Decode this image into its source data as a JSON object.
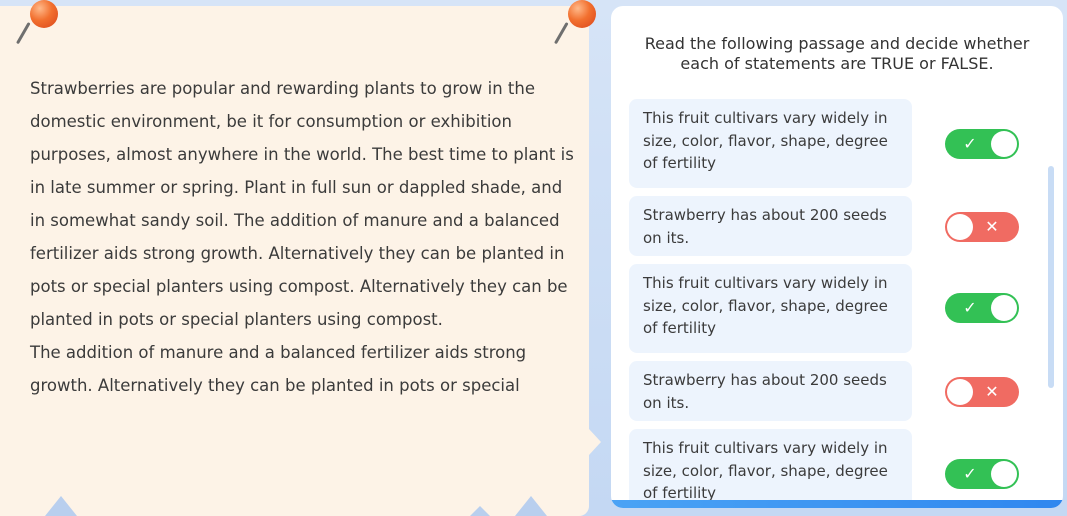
{
  "passage": {
    "paragraphs": [
      "Strawberries are popular and rewarding plants to grow in the domestic environment, be it for consumption or exhibition purposes, almost anywhere in the world. The best time to plant is in late summer or spring. Plant in full sun or dappled shade, and in somewhat sandy soil. The addition of manure and a balanced fertilizer aids strong growth. Alternatively they can be planted in pots or special planters using compost. Alternatively they can be planted in pots or special planters using compost.",
      "The addition of manure and a balanced fertilizer aids strong growth. Alternatively they can be planted in pots or special"
    ]
  },
  "panel": {
    "instructions": "Read the following passage and decide whether each of statements are TRUE or FALSE.",
    "statements": [
      {
        "text": "This fruit cultivars vary widely in size, color, flavor, shape, degree of fertility",
        "answer": "true"
      },
      {
        "text": "Strawberry has about 200 seeds on its.",
        "answer": "false"
      },
      {
        "text": "This fruit cultivars vary widely in size, color, flavor, shape, degree of fertility",
        "answer": "true"
      },
      {
        "text": "Strawberry has about 200 seeds on its.",
        "answer": "false"
      },
      {
        "text": "This fruit cultivars vary widely in size, color, flavor, shape, degree of fertility",
        "answer": "true"
      }
    ]
  },
  "icons": {
    "true_mark": "✓",
    "false_mark": "✕"
  },
  "colors": {
    "toggle_true": "#33c155",
    "toggle_false": "#f06b62",
    "passage_bg": "#fdf3e7"
  }
}
